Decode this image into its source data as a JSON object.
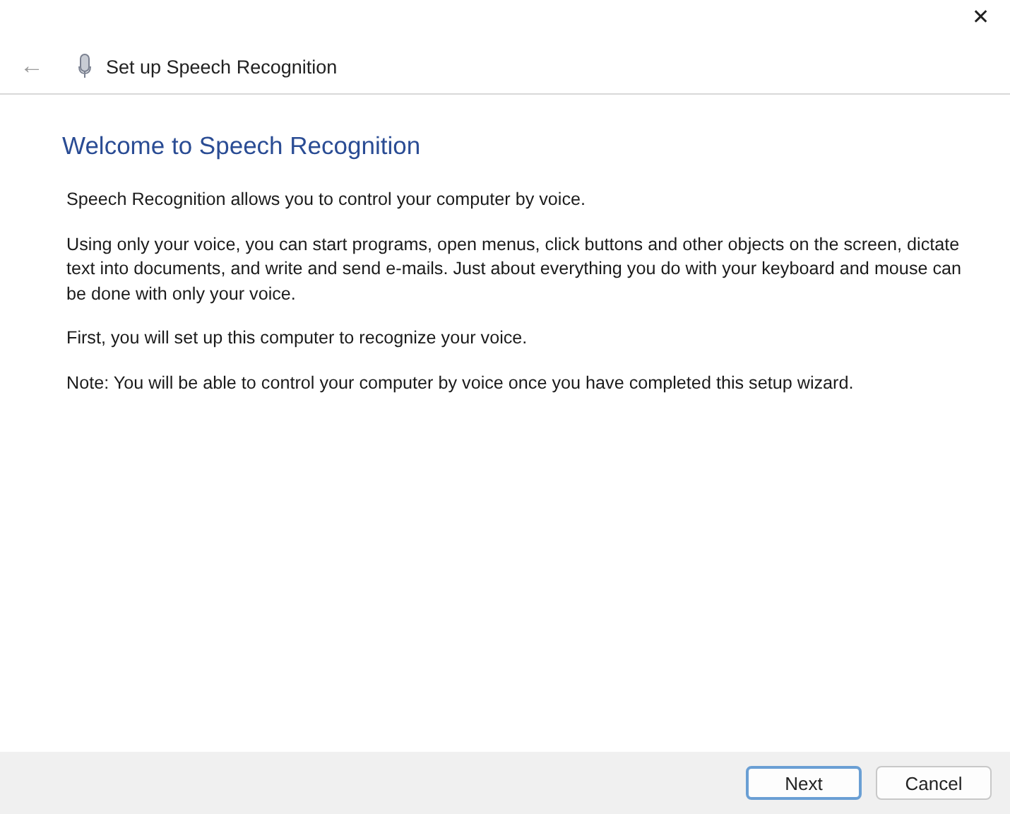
{
  "window": {
    "close": "✕"
  },
  "header": {
    "back": "←",
    "title": "Set up Speech Recognition"
  },
  "heading": "Welcome to Speech Recognition",
  "paragraphs": [
    "Speech Recognition allows you to control your computer by voice.",
    "Using only your voice, you can start programs, open menus, click buttons and other objects on the screen, dictate text into documents, and write and send e-mails. Just about everything you do with your keyboard and mouse can be done with only your voice.",
    "First, you will set up this computer to recognize your voice.",
    "Note: You will be able to control your computer by voice once you have completed this setup wizard."
  ],
  "buttons": [
    {
      "label": "Next",
      "default": true
    },
    {
      "label": "Cancel",
      "default": false
    }
  ]
}
